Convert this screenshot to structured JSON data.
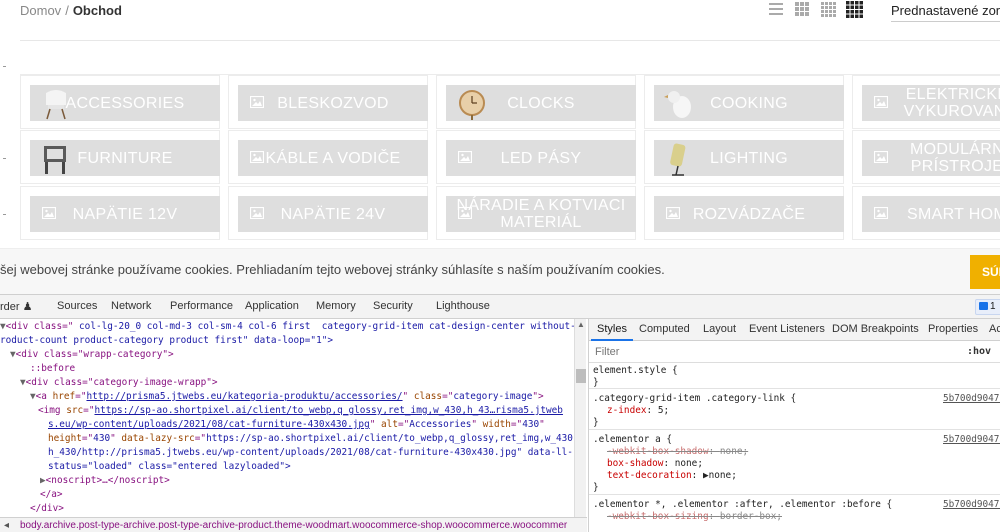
{
  "site": {
    "breadcrumb": {
      "home": "Domov",
      "separator": "/",
      "current": "Obchod"
    },
    "view_icons": [
      "list-view-icon",
      "grid-2-icon",
      "grid-3-icon",
      "grid-4-icon"
    ],
    "sort_label": "Prednastavené zor",
    "categories": [
      {
        "label": "ACCESSORIES",
        "icon": "chair-thumbnail"
      },
      {
        "label": "BLESKOZVOD",
        "icon": "image-placeholder-icon"
      },
      {
        "label": "CLOCKS",
        "icon": "clock-thumbnail"
      },
      {
        "label": "COOKING",
        "icon": "bird-thumbnail"
      },
      {
        "label": "ELEKTRICKÉ VYKUROVANI",
        "icon": "image-placeholder-icon"
      },
      {
        "label": "FURNITURE",
        "icon": "furniture-thumbnail"
      },
      {
        "label": "KÁBLE A VODIČE",
        "icon": "image-placeholder-icon"
      },
      {
        "label": "LED PÁSY",
        "icon": "image-placeholder-icon"
      },
      {
        "label": "LIGHTING",
        "icon": "lamp-thumbnail"
      },
      {
        "label": "MODULÁRN PRÍSTROJE",
        "icon": "image-placeholder-icon"
      },
      {
        "label": "NAPÄTIE 12V",
        "icon": "image-placeholder-icon"
      },
      {
        "label": "NAPÄTIE 24V",
        "icon": "image-placeholder-icon"
      },
      {
        "label": "NÁRADIE A KOTVIACI MATERIÁL",
        "icon": "image-placeholder-icon"
      },
      {
        "label": "ROZVÁDZAČE",
        "icon": "image-placeholder-icon"
      },
      {
        "label": "SMART HOM",
        "icon": "image-placeholder-icon"
      }
    ]
  },
  "cookie": {
    "text": "šej webovej stránke používame cookies. Prehliadaním tejto webovej stránky súhlasíte s naším používaním cookies.",
    "button": "SÚH"
  },
  "devtools": {
    "tabs": [
      "rder",
      "Sources",
      "Network",
      "Performance",
      "Application",
      "Memory",
      "Security",
      "Lighthouse"
    ],
    "issues_count": "1",
    "elements": {
      "line1_tag_open": "<div class=\"",
      "line1_class": " col-lg-20_0 col-md-3 col-sm-4 col-6 first  category-grid-item cat-design-center without-p",
      "line2": "roduct-count product-category product first\" data-loop=\"1\">",
      "line3": "<div class=\"wrapp-category\">",
      "line4": "::before",
      "line5": "<div class=\"category-image-wrapp\">",
      "line6_href": "http://prisma5.jtwebs.eu/kategoria-produktu/accessories/",
      "line6_class": "category-image",
      "line7_src": "https://sp-ao.shortpixel.ai/client/to_webp,q_glossy,ret_img,w_430,h_43…risma5.jtweb",
      "line8_src_cont": "s.eu/wp-content/uploads/2021/08/cat-furniture-430x430.jpg",
      "line8_alt": "Accessories",
      "line8_width": "430",
      "line9_height": "430",
      "line9_lazy": "https://sp-ao.shortpixel.ai/client/to_webp,q_glossy,ret_img,w_430,",
      "line10": "h_430/http://prisma5.jtwebs.eu/wp-content/uploads/2021/08/cat-furniture-430x430.jpg\" data-ll-",
      "line11": "status=\"loaded\" class=\"entered lazyloaded\">",
      "line12": "<noscript>…</noscript>",
      "line13": "</a>",
      "line14": "</div>"
    },
    "breadcrumb_bar": "body.archive.post-type-archive.post-type-archive-product.theme-woodmart.woocommerce-shop.woocommerce.woocommer",
    "styles_tabs": [
      "Styles",
      "Computed",
      "Layout",
      "Event Listeners",
      "DOM Breakpoints",
      "Properties",
      "Ac"
    ],
    "filter_placeholder": "Filter",
    "hov": ":hov",
    "rules": {
      "r1_selector": "element.style {",
      "r1_close": "}",
      "r2_selector": ".category-grid-item .category-link {",
      "r2_source": "5b700d9047!",
      "r2_prop": "z-index",
      "r2_val": "5;",
      "r2_close": "}",
      "r3_selector": ".elementor a {",
      "r3_source": "5b700d9047!",
      "r3_p1": "-webkit-box-shadow",
      "r3_v1": "none;",
      "r3_p2": "box-shadow",
      "r3_v2": "none;",
      "r3_p3": "text-decoration",
      "r3_v3": "none;",
      "r3_close": "}",
      "r4_selector": ".elementor *, .elementor :after, .elementor :before {",
      "r4_source": "5b700d9047!",
      "r4_p1": "-webkit-box-sizing",
      "r4_v1": "border-box;"
    }
  }
}
